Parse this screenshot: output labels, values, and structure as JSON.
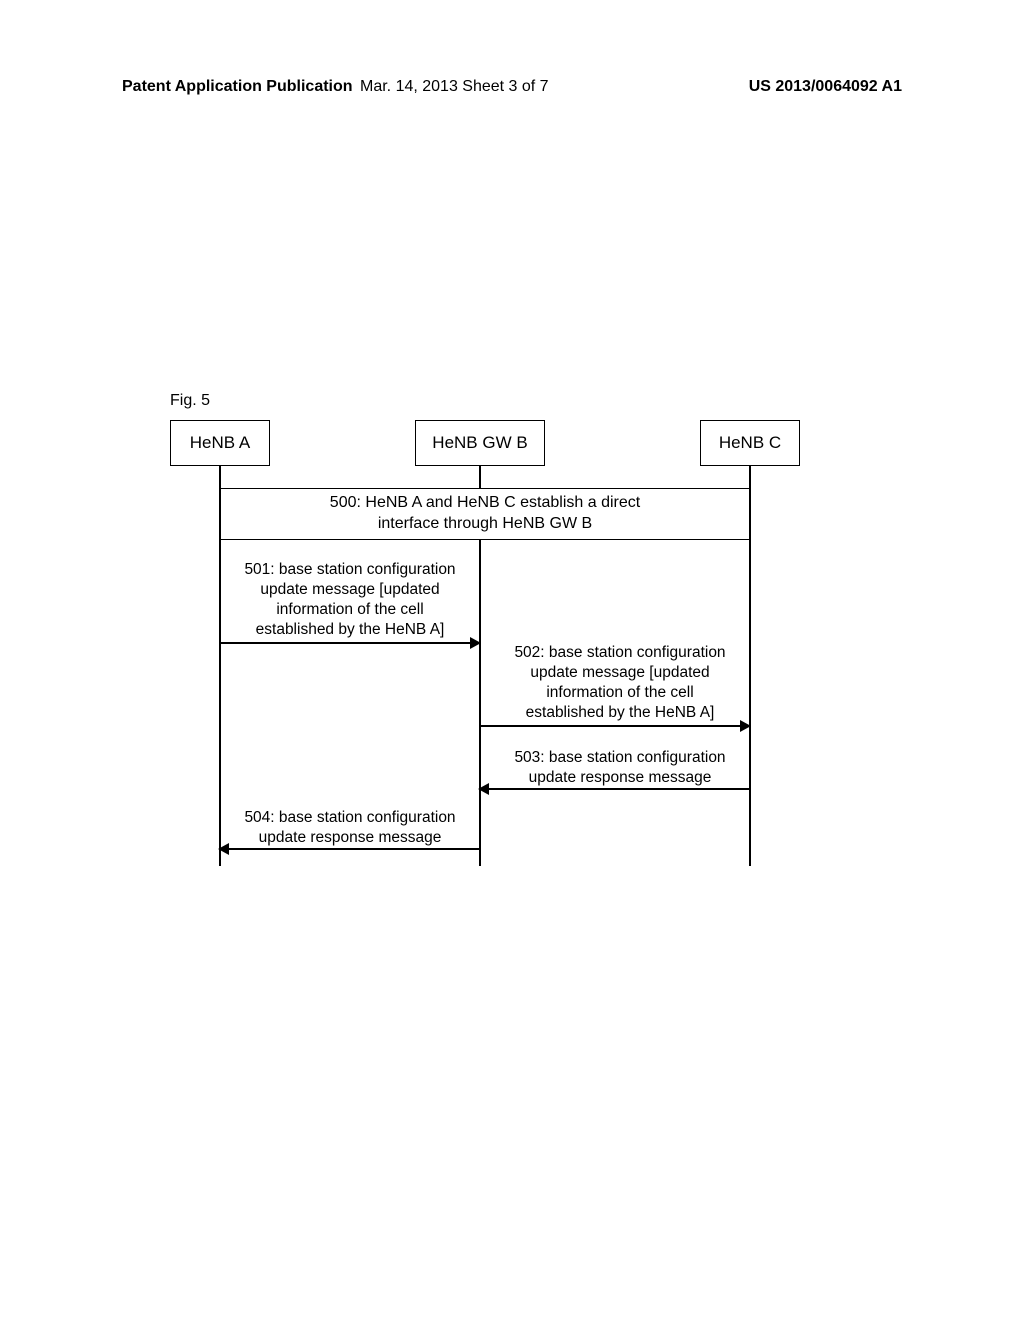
{
  "header": {
    "left": "Patent Application Publication",
    "center": "Mar. 14, 2013  Sheet 3 of 7",
    "right": "US 2013/0064092 A1"
  },
  "figure": {
    "label": "Fig. 5",
    "nodes": {
      "a": "HeNB A",
      "b": "HeNB GW B",
      "c": "HeNB C"
    },
    "steps": {
      "s500_l1": "500: HeNB A and HeNB C establish a direct",
      "s500_l2": "interface through HeNB GW B",
      "s501_l1": "501: base station configuration",
      "s501_l2": "update message [updated",
      "s501_l3": "information of the cell",
      "s501_l4": "established by the HeNB A]",
      "s502_l1": "502: base station configuration",
      "s502_l2": "update message [updated",
      "s502_l3": "information of the cell",
      "s502_l4": "established by the HeNB A]",
      "s503_l1": "503: base station configuration",
      "s503_l2": "update response message",
      "s504_l1": "504: base station configuration",
      "s504_l2": "update response message"
    }
  }
}
